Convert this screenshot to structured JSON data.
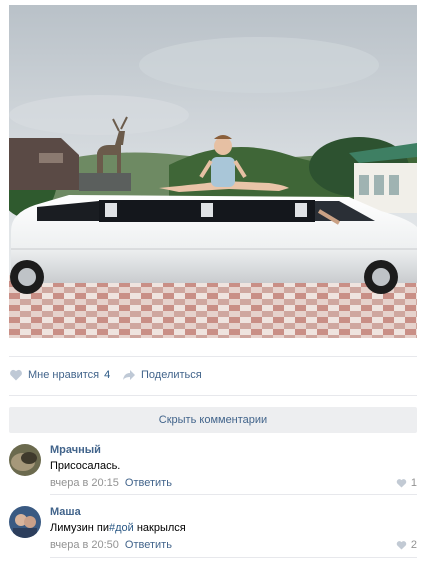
{
  "post": {
    "photo_alt": "",
    "like_label": "Мне нравится",
    "like_count": "4",
    "share_label": "Поделиться",
    "icons": {
      "like": "heart-icon",
      "share": "share-arrow-icon"
    }
  },
  "comments_block": {
    "hide_label": "Скрыть комментарии",
    "items": [
      {
        "author": "Мрачный",
        "text": "Присосалась.",
        "date": "вчера в 20:15",
        "reply_label": "Ответить",
        "likes": "1"
      },
      {
        "author": "Маша",
        "text_before": "Лимузин пи",
        "mention": "#дой",
        "text_after": " накрылся",
        "date": "вчера в 20:50",
        "reply_label": "Ответить",
        "likes": "2"
      }
    ]
  },
  "colors": {
    "link": "#42648b",
    "muted": "#939393",
    "panel": "#edeef0",
    "divider": "#e7e8ec"
  }
}
